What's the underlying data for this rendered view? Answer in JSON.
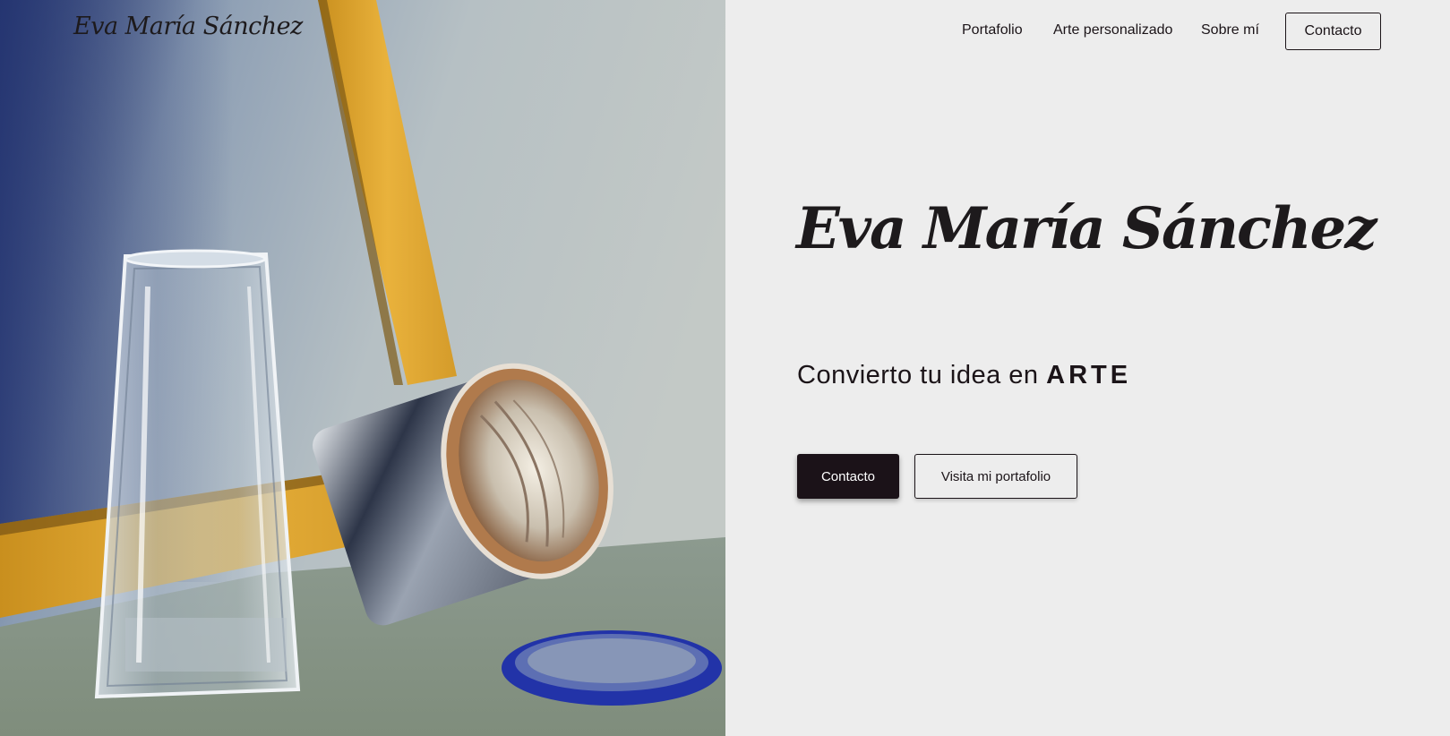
{
  "header": {
    "logo_text": "Eva María Sánchez",
    "nav": [
      {
        "label": "Portafolio"
      },
      {
        "label": "Arte personalizado"
      },
      {
        "label": "Sobre mí"
      },
      {
        "label": "Contacto"
      }
    ]
  },
  "hero": {
    "title": "Eva María Sánchez",
    "tagline_prefix": "Convierto tu idea en ",
    "tagline_emphasis": "ARTE",
    "primary_button": "Contacto",
    "secondary_button": "Visita mi portafolio"
  },
  "colors": {
    "background": "#ededed",
    "text": "#1b1418",
    "primary_button_bg": "#1b1218"
  }
}
